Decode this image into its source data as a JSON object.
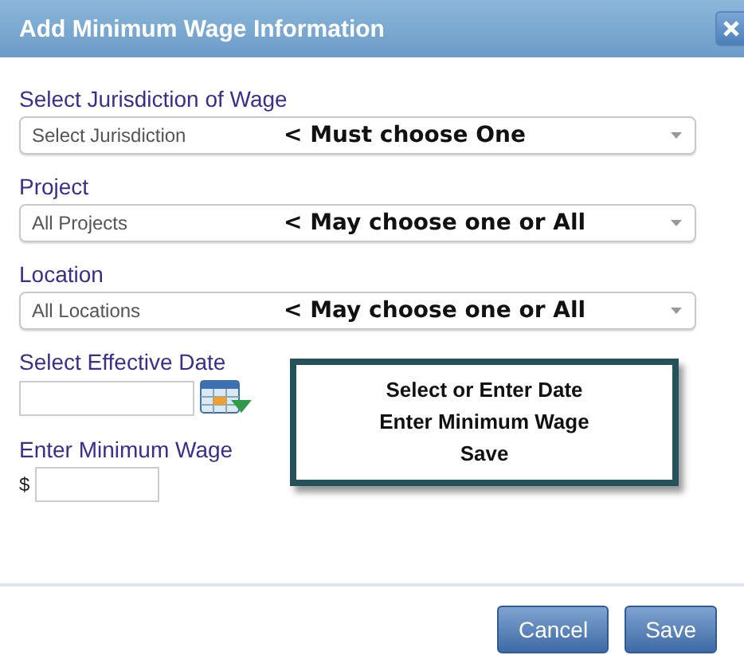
{
  "dialog": {
    "title": "Add Minimum Wage Information"
  },
  "selects": [
    {
      "label": "Select Jurisdiction of Wage",
      "value": "Select Jurisdiction",
      "note": "< Must choose One"
    },
    {
      "label": "Project",
      "value": "All Projects",
      "note": "< May choose one or All"
    },
    {
      "label": "Location",
      "value": "All Locations",
      "note": "< May choose one or All"
    }
  ],
  "date": {
    "label": "Select Effective Date"
  },
  "wage": {
    "label": "Enter Minimum Wage",
    "currency": "$"
  },
  "callout": {
    "lines": [
      "Select or Enter Date",
      "Enter Minimum Wage",
      "Save"
    ]
  },
  "buttons": [
    "Cancel",
    "Save"
  ]
}
